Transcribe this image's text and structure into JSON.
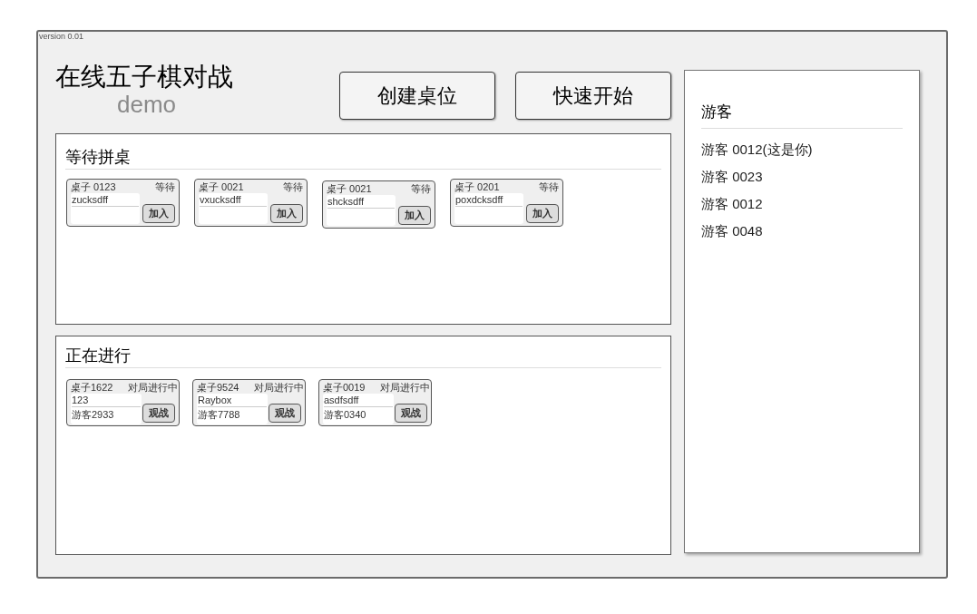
{
  "version": "version 0.01",
  "title": "在线五子棋对战",
  "subtitle": "demo",
  "buttons": [
    "创建桌位",
    "快速开始"
  ],
  "waiting": {
    "heading": "等待拼桌",
    "tables": [
      {
        "name": "桌子 0123",
        "status": "等待",
        "player": "zucksdff",
        "button": "加入"
      },
      {
        "name": "桌子 0021",
        "status": "等待",
        "player": "vxucksdff",
        "button": "加入"
      },
      {
        "name": "桌子 0021",
        "status": "等待",
        "player": "shcksdff",
        "button": "加入"
      },
      {
        "name": "桌子 0201",
        "status": "等待",
        "player": "poxdcksdff",
        "button": "加入"
      }
    ]
  },
  "playing": {
    "heading": "正在进行",
    "tables": [
      {
        "name": "桌子1622",
        "status": "对局进行中",
        "player_1": "123",
        "player_2": "游客2933",
        "button": "观战"
      },
      {
        "name": "桌子9524",
        "status": "对局进行中",
        "player_1": "Raybox",
        "player_2": "游客7788",
        "button": "观战"
      },
      {
        "name": "桌子0019",
        "status": "对局进行中",
        "player_1": "asdfsdff",
        "player_2": "游客0340",
        "button": "观战"
      }
    ]
  },
  "guests": {
    "heading": "游客",
    "items": [
      "游客 0012(这是你)",
      "游客 0023",
      "游客 0012",
      "游客 0048"
    ]
  }
}
